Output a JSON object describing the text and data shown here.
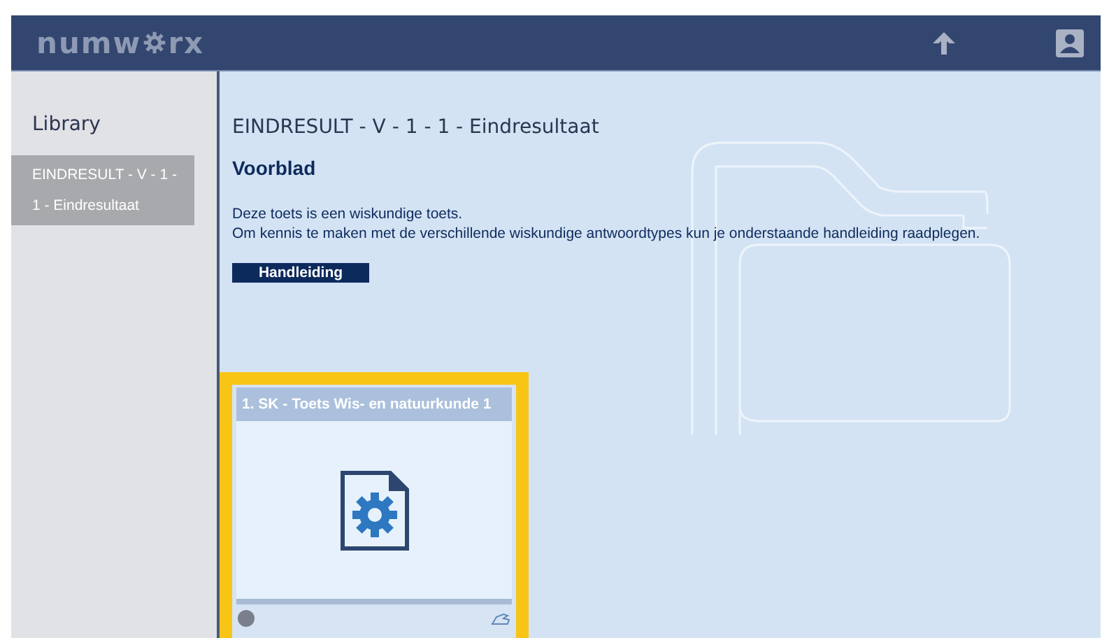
{
  "header": {
    "logo_start": "numw",
    "logo_end": "rx"
  },
  "sidebar": {
    "title": "Library",
    "items": [
      {
        "label": "EINDRESULT - V - 1 - 1 - Eindresultaat",
        "selected": true
      }
    ]
  },
  "main": {
    "title": "EINDRESULT - V - 1 - 1 - Eindresultaat",
    "heading": "Voorblad",
    "paragraphs": [
      "Deze toets is een wiskundige toets.",
      "Om kennis te maken met de verschillende wiskundige antwoordtypes kun je onderstaande handleiding raadplegen."
    ],
    "button": "Handleiding",
    "cards": [
      {
        "title": "1. SK - Toets Wis- en natuurkunde 1",
        "selected": true
      }
    ]
  }
}
